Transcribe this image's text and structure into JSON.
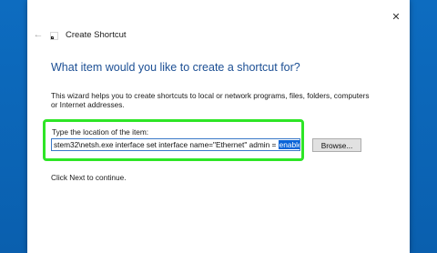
{
  "window": {
    "title": "Create Shortcut",
    "close_glyph": "✕",
    "back_glyph": "←"
  },
  "wizard": {
    "heading": "What item would you like to create a shortcut for?",
    "description": "This wizard helps you to create shortcuts to local or network programs, files, folders, computers or Internet addresses.",
    "location_label": "Type the location of the item:",
    "location_value_prefix": "stem32\\netsh.exe interface set interface name=\"Ethernet\" admin = ",
    "location_value_selected": "enabled",
    "browse_label": "Browse...",
    "next_hint": "Click Next to continue."
  },
  "icons": {
    "back": "back-arrow-icon",
    "close": "close-icon",
    "title": "shortcut-icon"
  },
  "colors": {
    "desktop": "#0a64b4",
    "heading": "#1c4f94",
    "highlight": "#2ee526",
    "selection": "#0a64d8",
    "input_border": "#3a78c8"
  }
}
